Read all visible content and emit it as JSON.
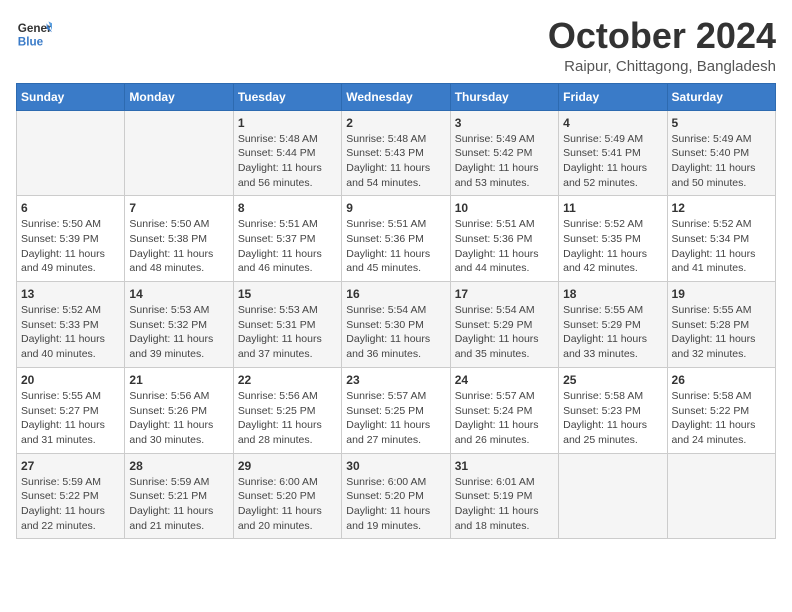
{
  "header": {
    "logo_line1": "General",
    "logo_line2": "Blue",
    "month": "October 2024",
    "location": "Raipur, Chittagong, Bangladesh"
  },
  "weekdays": [
    "Sunday",
    "Monday",
    "Tuesday",
    "Wednesday",
    "Thursday",
    "Friday",
    "Saturday"
  ],
  "weeks": [
    [
      {
        "day": "",
        "sunrise": "",
        "sunset": "",
        "daylight": ""
      },
      {
        "day": "",
        "sunrise": "",
        "sunset": "",
        "daylight": ""
      },
      {
        "day": "1",
        "sunrise": "Sunrise: 5:48 AM",
        "sunset": "Sunset: 5:44 PM",
        "daylight": "Daylight: 11 hours and 56 minutes."
      },
      {
        "day": "2",
        "sunrise": "Sunrise: 5:48 AM",
        "sunset": "Sunset: 5:43 PM",
        "daylight": "Daylight: 11 hours and 54 minutes."
      },
      {
        "day": "3",
        "sunrise": "Sunrise: 5:49 AM",
        "sunset": "Sunset: 5:42 PM",
        "daylight": "Daylight: 11 hours and 53 minutes."
      },
      {
        "day": "4",
        "sunrise": "Sunrise: 5:49 AM",
        "sunset": "Sunset: 5:41 PM",
        "daylight": "Daylight: 11 hours and 52 minutes."
      },
      {
        "day": "5",
        "sunrise": "Sunrise: 5:49 AM",
        "sunset": "Sunset: 5:40 PM",
        "daylight": "Daylight: 11 hours and 50 minutes."
      }
    ],
    [
      {
        "day": "6",
        "sunrise": "Sunrise: 5:50 AM",
        "sunset": "Sunset: 5:39 PM",
        "daylight": "Daylight: 11 hours and 49 minutes."
      },
      {
        "day": "7",
        "sunrise": "Sunrise: 5:50 AM",
        "sunset": "Sunset: 5:38 PM",
        "daylight": "Daylight: 11 hours and 48 minutes."
      },
      {
        "day": "8",
        "sunrise": "Sunrise: 5:51 AM",
        "sunset": "Sunset: 5:37 PM",
        "daylight": "Daylight: 11 hours and 46 minutes."
      },
      {
        "day": "9",
        "sunrise": "Sunrise: 5:51 AM",
        "sunset": "Sunset: 5:36 PM",
        "daylight": "Daylight: 11 hours and 45 minutes."
      },
      {
        "day": "10",
        "sunrise": "Sunrise: 5:51 AM",
        "sunset": "Sunset: 5:36 PM",
        "daylight": "Daylight: 11 hours and 44 minutes."
      },
      {
        "day": "11",
        "sunrise": "Sunrise: 5:52 AM",
        "sunset": "Sunset: 5:35 PM",
        "daylight": "Daylight: 11 hours and 42 minutes."
      },
      {
        "day": "12",
        "sunrise": "Sunrise: 5:52 AM",
        "sunset": "Sunset: 5:34 PM",
        "daylight": "Daylight: 11 hours and 41 minutes."
      }
    ],
    [
      {
        "day": "13",
        "sunrise": "Sunrise: 5:52 AM",
        "sunset": "Sunset: 5:33 PM",
        "daylight": "Daylight: 11 hours and 40 minutes."
      },
      {
        "day": "14",
        "sunrise": "Sunrise: 5:53 AM",
        "sunset": "Sunset: 5:32 PM",
        "daylight": "Daylight: 11 hours and 39 minutes."
      },
      {
        "day": "15",
        "sunrise": "Sunrise: 5:53 AM",
        "sunset": "Sunset: 5:31 PM",
        "daylight": "Daylight: 11 hours and 37 minutes."
      },
      {
        "day": "16",
        "sunrise": "Sunrise: 5:54 AM",
        "sunset": "Sunset: 5:30 PM",
        "daylight": "Daylight: 11 hours and 36 minutes."
      },
      {
        "day": "17",
        "sunrise": "Sunrise: 5:54 AM",
        "sunset": "Sunset: 5:29 PM",
        "daylight": "Daylight: 11 hours and 35 minutes."
      },
      {
        "day": "18",
        "sunrise": "Sunrise: 5:55 AM",
        "sunset": "Sunset: 5:29 PM",
        "daylight": "Daylight: 11 hours and 33 minutes."
      },
      {
        "day": "19",
        "sunrise": "Sunrise: 5:55 AM",
        "sunset": "Sunset: 5:28 PM",
        "daylight": "Daylight: 11 hours and 32 minutes."
      }
    ],
    [
      {
        "day": "20",
        "sunrise": "Sunrise: 5:55 AM",
        "sunset": "Sunset: 5:27 PM",
        "daylight": "Daylight: 11 hours and 31 minutes."
      },
      {
        "day": "21",
        "sunrise": "Sunrise: 5:56 AM",
        "sunset": "Sunset: 5:26 PM",
        "daylight": "Daylight: 11 hours and 30 minutes."
      },
      {
        "day": "22",
        "sunrise": "Sunrise: 5:56 AM",
        "sunset": "Sunset: 5:25 PM",
        "daylight": "Daylight: 11 hours and 28 minutes."
      },
      {
        "day": "23",
        "sunrise": "Sunrise: 5:57 AM",
        "sunset": "Sunset: 5:25 PM",
        "daylight": "Daylight: 11 hours and 27 minutes."
      },
      {
        "day": "24",
        "sunrise": "Sunrise: 5:57 AM",
        "sunset": "Sunset: 5:24 PM",
        "daylight": "Daylight: 11 hours and 26 minutes."
      },
      {
        "day": "25",
        "sunrise": "Sunrise: 5:58 AM",
        "sunset": "Sunset: 5:23 PM",
        "daylight": "Daylight: 11 hours and 25 minutes."
      },
      {
        "day": "26",
        "sunrise": "Sunrise: 5:58 AM",
        "sunset": "Sunset: 5:22 PM",
        "daylight": "Daylight: 11 hours and 24 minutes."
      }
    ],
    [
      {
        "day": "27",
        "sunrise": "Sunrise: 5:59 AM",
        "sunset": "Sunset: 5:22 PM",
        "daylight": "Daylight: 11 hours and 22 minutes."
      },
      {
        "day": "28",
        "sunrise": "Sunrise: 5:59 AM",
        "sunset": "Sunset: 5:21 PM",
        "daylight": "Daylight: 11 hours and 21 minutes."
      },
      {
        "day": "29",
        "sunrise": "Sunrise: 6:00 AM",
        "sunset": "Sunset: 5:20 PM",
        "daylight": "Daylight: 11 hours and 20 minutes."
      },
      {
        "day": "30",
        "sunrise": "Sunrise: 6:00 AM",
        "sunset": "Sunset: 5:20 PM",
        "daylight": "Daylight: 11 hours and 19 minutes."
      },
      {
        "day": "31",
        "sunrise": "Sunrise: 6:01 AM",
        "sunset": "Sunset: 5:19 PM",
        "daylight": "Daylight: 11 hours and 18 minutes."
      },
      {
        "day": "",
        "sunrise": "",
        "sunset": "",
        "daylight": ""
      },
      {
        "day": "",
        "sunrise": "",
        "sunset": "",
        "daylight": ""
      }
    ]
  ]
}
